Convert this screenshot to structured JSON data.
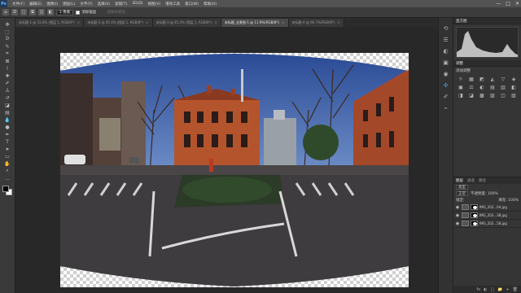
{
  "app": {
    "logo": "Ps"
  },
  "menu": [
    "文件(F)",
    "编辑(E)",
    "图像(I)",
    "图层(L)",
    "文字(Y)",
    "选择(S)",
    "滤镜(T)",
    "3D(D)",
    "视图(V)",
    "增效工具",
    "窗口(W)",
    "帮助(H)"
  ],
  "window_controls": {
    "minimize": "—",
    "maximize": "□",
    "close": "✕"
  },
  "options_bar": {
    "feather": "1 像素",
    "anti_alias_label": "消除锯齿",
    "hint": "选择并遮住..."
  },
  "tabs": [
    {
      "label": "未标题-1 @ 33.4% (图层 1, RGB/8*)",
      "active": false
    },
    {
      "label": "未标题-2 @ 45.4% (图层 1, RGB/8*)",
      "active": false
    },
    {
      "label": "未标题-3 @ 45.4% (图层 1, RGB/8*)",
      "active": false
    },
    {
      "label": "未标题_全景图-1 @ 11.9%(RGB/8*)",
      "active": true
    },
    {
      "label": "未标题-4 @ 66.7%(RGB/8*)",
      "active": false
    }
  ],
  "tab_close": "×",
  "tools": [
    "move",
    "marquee",
    "lasso",
    "quick-select",
    "crop",
    "frame",
    "eyedropper",
    "healing",
    "brush",
    "clone-stamp",
    "history-brush",
    "eraser",
    "gradient",
    "blur",
    "dodge",
    "pen",
    "type",
    "path-select",
    "rectangle",
    "hand",
    "zoom",
    "more"
  ],
  "strip_icons": [
    "history",
    "properties",
    "adjustments",
    "libraries",
    "color",
    "swatches",
    "brushes",
    "paths"
  ],
  "panels": {
    "histogram_title": "直方图",
    "adjustments_tab": "调整",
    "adjustments_title": "添加调整",
    "adj_icons": [
      "☼",
      "▦",
      "◩",
      "◭",
      "▽",
      "◈",
      "▣",
      "⚖",
      "◐",
      "▤",
      "▥",
      "◧",
      "◨",
      "◪",
      "▩",
      "▨",
      "◫",
      "▧"
    ]
  },
  "layers": {
    "tabs": [
      "图层",
      "通道",
      "路径"
    ],
    "kind": "类型",
    "blend_mode": "正常",
    "opacity": "不透明度: 100%",
    "lock": "锁定:",
    "fill": "填充: 100%",
    "items": [
      {
        "name": "IMG_202...04.jpg"
      },
      {
        "name": "IMG_202...38.jpg"
      },
      {
        "name": "IMG_202...58.jpg"
      }
    ],
    "footer_icons": [
      "fx",
      "◐",
      "▢",
      "📁",
      "+",
      "🗑"
    ]
  },
  "colors": {
    "menubar": "#535353",
    "sky": "#3b5ba8",
    "brick": "#b4542d"
  }
}
